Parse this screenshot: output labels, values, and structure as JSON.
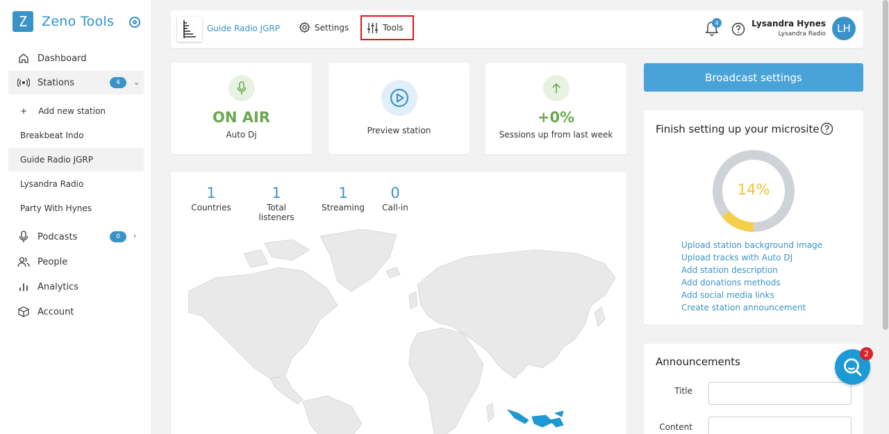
{
  "brand": {
    "logo_letter": "Z",
    "name": "Zeno Tools"
  },
  "sidebar": {
    "dashboard": "Dashboard",
    "stations": "Stations",
    "stations_count": "4",
    "add_station": "Add new station",
    "station_list": [
      "Breakbeat Indo",
      "Guide Radio JGRP",
      "Lysandra Radio",
      "Party With Hynes"
    ],
    "podcasts": "Podcasts",
    "podcasts_count": "0",
    "people": "People",
    "analytics": "Analytics",
    "account": "Account"
  },
  "topbar": {
    "station_name": "Guide Radio JGRP",
    "settings_label": "Settings",
    "tools_label": "Tools",
    "notifications_count": "4",
    "user_name": "Lysandra Hynes",
    "user_station": "Lysandra Radio",
    "avatar_initials": "LH"
  },
  "stats": {
    "status": "ON AIR",
    "status_sub": "Auto Dj",
    "preview_label": "Preview station",
    "sessions_change": "+0%",
    "sessions_sub": "Sessions up from last week"
  },
  "metrics": [
    {
      "value": "1",
      "label": "Countries"
    },
    {
      "value": "1",
      "label": "Total listeners"
    },
    {
      "value": "1",
      "label": "Streaming"
    },
    {
      "value": "0",
      "label": "Call-in"
    }
  ],
  "broadcast_button": "Broadcast settings",
  "microsite": {
    "title": "Finish setting up your microsite",
    "progress_label": "14%",
    "progress_fraction": 0.14,
    "links": [
      "Upload station background image",
      "Upload tracks with Auto DJ",
      "Add station description",
      "Add donations methods",
      "Add social media links",
      "Create station announcement"
    ]
  },
  "announcements": {
    "title": "Announcements",
    "title_label": "Title",
    "content_label": "Content"
  },
  "chat": {
    "count": "2"
  },
  "colors": {
    "brand_blue": "#3a93c8",
    "on_air_green": "#6aa84f",
    "progress_yellow": "#f6cf4a",
    "highlight_red": "#e0131a"
  }
}
